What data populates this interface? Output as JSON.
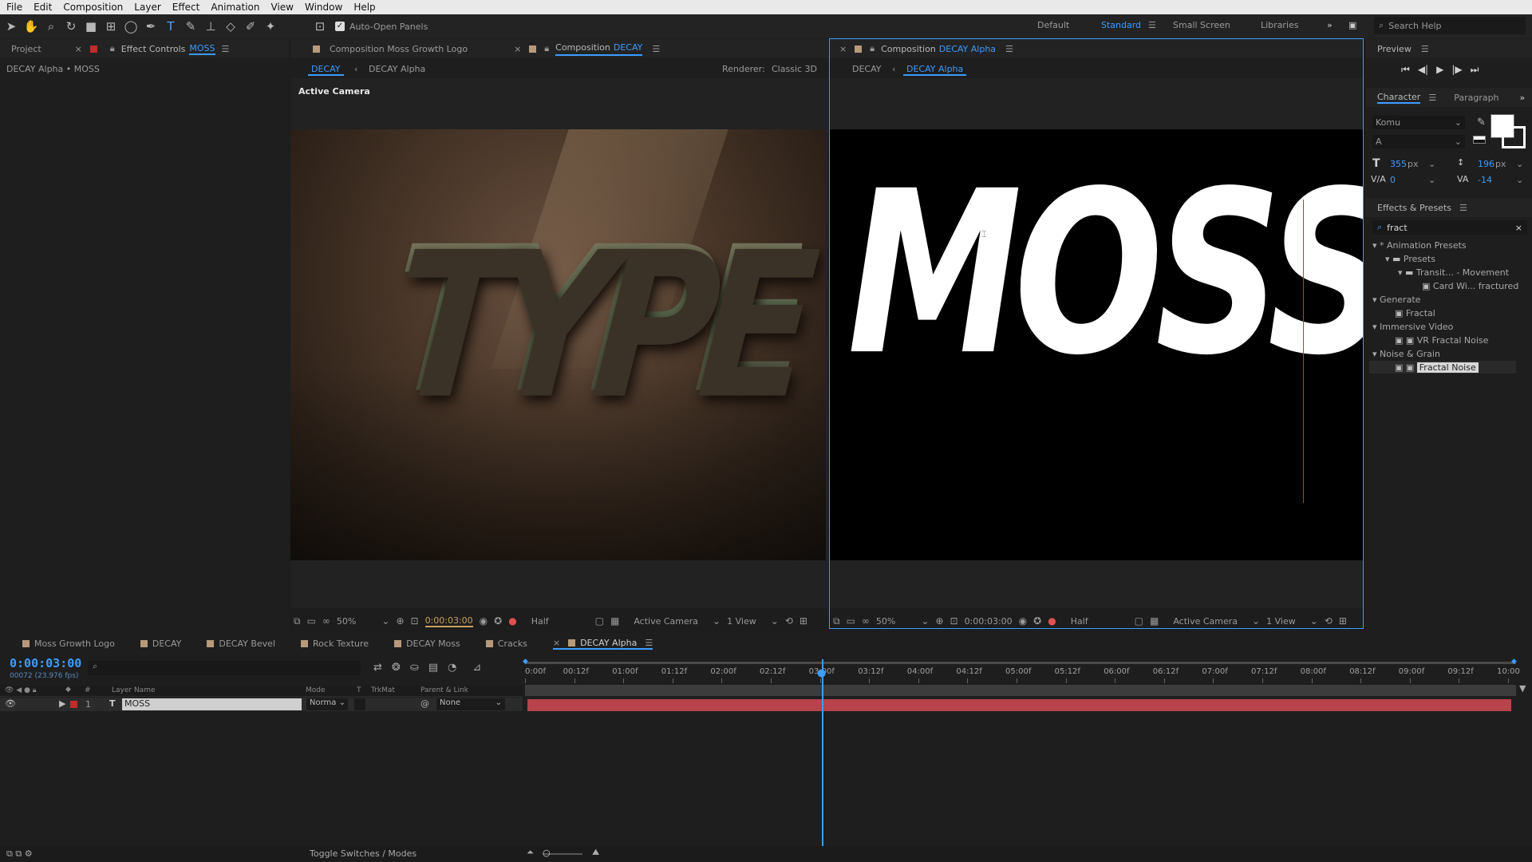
{
  "menu": [
    "File",
    "Edit",
    "Composition",
    "Layer",
    "Effect",
    "Animation",
    "View",
    "Window",
    "Help"
  ],
  "toolbar": {
    "auto_open_label": "Auto-Open Panels"
  },
  "workspaces": [
    "Default",
    "Standard",
    "Small Screen",
    "Libraries"
  ],
  "search_help": "Search Help",
  "left_panel": {
    "tab_project": "Project",
    "tab_effect_controls": "Effect Controls",
    "effect_target": "MOSS",
    "subtitle": "DECAY Alpha • MOSS"
  },
  "comp1": {
    "tab1": "Composition Moss Growth Logo",
    "tab2_prefix": "Composition",
    "tab2_name": "DECAY",
    "crumb1": "DECAY",
    "crumb2": "DECAY Alpha",
    "renderer_label": "Renderer:",
    "renderer_value": "Classic 3D",
    "camera_label": "Active Camera",
    "art_text": "TYPE",
    "zoom": "50%",
    "time": "0:00:03:00",
    "quality": "Half",
    "view_camera": "Active Camera",
    "view_count": "1 View"
  },
  "comp2": {
    "tab_prefix": "Composition",
    "tab_name": "DECAY Alpha",
    "crumb1": "DECAY",
    "crumb2": "DECAY Alpha",
    "art_text": "MOSS",
    "zoom": "50%",
    "time": "0:00:03:00",
    "quality": "Half",
    "view_camera": "Active Camera",
    "view_count": "1 View"
  },
  "preview": {
    "title": "Preview"
  },
  "character": {
    "tab_character": "Character",
    "tab_paragraph": "Paragraph",
    "font": "Komu",
    "style": "A",
    "size": "355",
    "size_unit": "px",
    "leading": "196",
    "leading_unit": "px",
    "kerning": "0",
    "tracking": "-14"
  },
  "effects": {
    "title": "Effects & Presets",
    "search": "fract",
    "tree": [
      "* Animation Presets",
      "Presets",
      "Transit... - Movement",
      "Card Wi... fractured",
      "Generate",
      "Fractal",
      "Immersive Video",
      "VR Fractal Noise",
      "Noise & Grain",
      "Fractal Noise"
    ]
  },
  "timeline": {
    "tabs": [
      "Moss Growth Logo",
      "DECAY",
      "DECAY Bevel",
      "Rock Texture",
      "DECAY Moss",
      "Cracks",
      "DECAY Alpha"
    ],
    "timecode": "0:00:03:00",
    "frames": "00072 (23.976 fps)",
    "col_layer_name": "Layer Name",
    "col_mode": "Mode",
    "col_t": "T",
    "col_trkmat": "TrkMat",
    "col_parent": "Parent & Link",
    "layer_num": "1",
    "layer_name": "MOSS",
    "layer_mode": "Norma",
    "layer_parent": "None",
    "ruler": [
      "0:00f",
      "00:12f",
      "01:00f",
      "01:12f",
      "02:00f",
      "02:12f",
      "03:00f",
      "03:12f",
      "04:00f",
      "04:12f",
      "05:00f",
      "05:12f",
      "06:00f",
      "06:12f",
      "07:00f",
      "07:12f",
      "08:00f",
      "08:12f",
      "09:00f",
      "09:12f",
      "10:00"
    ],
    "toggle_label": "Toggle Switches / Modes"
  },
  "colors": {
    "accent": "#3b9dff",
    "layer_bar": "#b8434a",
    "label_red": "#c42b2b"
  }
}
